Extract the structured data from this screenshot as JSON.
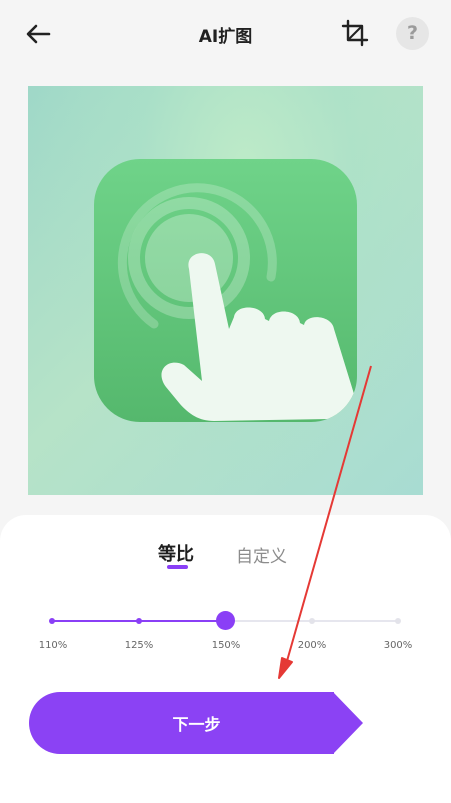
{
  "header": {
    "title": "AI扩图",
    "back_icon": "arrow-left-icon",
    "crop_icon": "crop-icon",
    "help_label": "?"
  },
  "preview": {
    "image_description_icon": "touch-hand-app-icon",
    "background_color": "#a8dcd2",
    "icon_color": "#5fc47a"
  },
  "tabs": [
    {
      "label": "等比",
      "selected": true
    },
    {
      "label": "自定义",
      "selected": false
    }
  ],
  "scale_slider": {
    "options": [
      "110%",
      "125%",
      "150%",
      "200%",
      "300%"
    ],
    "selected": "150%",
    "accent_color": "#8a3ff6"
  },
  "next_button": {
    "label": "下一步",
    "color": "#8b42f4"
  },
  "annotation": {
    "arrow_color": "#e53935"
  }
}
